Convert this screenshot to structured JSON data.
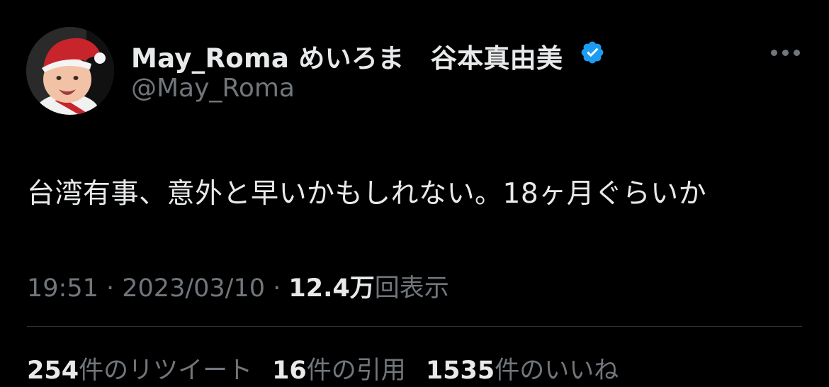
{
  "user": {
    "display_name": "May_Roma めいろま　谷本真由美",
    "handle": "@May_Roma",
    "verified_color": "#1d9bf0"
  },
  "tweet": {
    "text": "台湾有事、意外と早いかもしれない。18ヶ月ぐらいか"
  },
  "meta": {
    "time": "19:51",
    "separator": " · ",
    "date": "2023/03/10",
    "views_count": "12.4万",
    "views_label": "回表示"
  },
  "stats": {
    "retweets_count": "254",
    "retweets_label": "件のリツイート",
    "quotes_count": "16",
    "quotes_label": "件の引用",
    "likes_count": "1535",
    "likes_label": "件のいいね"
  },
  "icons": {
    "avatar": "avatar-baby-santa-hat",
    "verified": "verified-badge-icon",
    "more": "more-options-icon"
  }
}
